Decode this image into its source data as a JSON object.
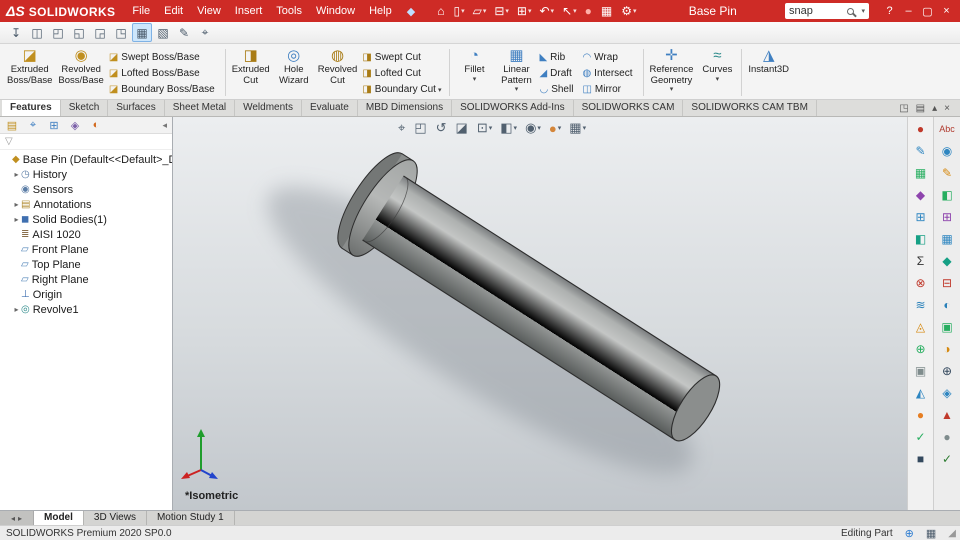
{
  "titlebar": {
    "logo_mark": "ΔS",
    "logo_text": "SOLIDWORKS",
    "menus": [
      "File",
      "Edit",
      "View",
      "Insert",
      "Tools",
      "Window",
      "Help"
    ],
    "pin_glyph": "◆",
    "quick_icons": [
      {
        "g": "⌂",
        "caret": ""
      },
      {
        "g": "▯",
        "caret": "▾"
      },
      {
        "g": "▱",
        "caret": "▾"
      },
      {
        "g": "⊟",
        "caret": "▾"
      },
      {
        "g": "⊞",
        "caret": "▾"
      },
      {
        "g": "↶",
        "caret": "▾"
      },
      {
        "g": "↖",
        "caret": "▾"
      },
      {
        "g": "●",
        "c": "#ffb0a8",
        "caret": ""
      },
      {
        "g": "▦",
        "caret": ""
      },
      {
        "g": "⚙",
        "caret": "▾"
      }
    ],
    "doc_title": "Base Pin",
    "search_value": "snap",
    "window_controls": [
      {
        "g": "?"
      },
      {
        "g": "–"
      },
      {
        "g": "▢"
      },
      {
        "g": "×"
      }
    ]
  },
  "quickbar": [
    {
      "g": "↧"
    },
    {
      "g": "◫"
    },
    {
      "g": "◰"
    },
    {
      "g": "◱"
    },
    {
      "g": "◲"
    },
    {
      "g": "◳"
    },
    {
      "g": "▦",
      "bg": "#cde6fb",
      "bc": "#7fb2e5"
    },
    {
      "g": "▧"
    },
    {
      "g": "✎"
    },
    {
      "g": "⌖"
    }
  ],
  "ribbon": {
    "large": [
      {
        "icon": "◪",
        "c": "#c08f1f",
        "label": "Extruded\nBoss/Base",
        "caret": ""
      },
      {
        "icon": "◉",
        "c": "#c08f1f",
        "label": "Revolved\nBoss/Base",
        "caret": ""
      },
      {
        "icon": "◨",
        "c": "#a97c16",
        "label": "Extruded\nCut",
        "caret": ""
      },
      {
        "icon": "◎",
        "c": "#3f7fc1",
        "label": "Hole\nWizard",
        "caret": ""
      },
      {
        "icon": "◍",
        "c": "#a97c16",
        "label": "Revolved\nCut",
        "caret": ""
      },
      {
        "icon": "◔",
        "c": "#3f7fc1",
        "label": "Fillet",
        "caret": "▾"
      },
      {
        "icon": "▦",
        "c": "#3f7fc1",
        "label": "Linear\nPattern",
        "caret": "▾"
      },
      {
        "icon": "✛",
        "c": "#3f7fc1",
        "label": "Reference\nGeometry",
        "caret": "▾"
      },
      {
        "icon": "≈",
        "c": "#2e8b8b",
        "label": "Curves",
        "caret": "▾"
      },
      {
        "icon": "◮",
        "c": "#3f7fc1",
        "label": "Instant3D",
        "caret": ""
      }
    ],
    "cols_boss": [
      {
        "g": "◪",
        "c": "#c08f1f",
        "label": "Swept Boss/Base",
        "caret": ""
      },
      {
        "g": "◪",
        "c": "#c08f1f",
        "label": "Lofted Boss/Base",
        "caret": ""
      },
      {
        "g": "◪",
        "c": "#c08f1f",
        "label": "Boundary Boss/Base",
        "caret": ""
      }
    ],
    "cols_cut": [
      {
        "g": "◨",
        "c": "#a97c16",
        "label": "Swept Cut",
        "caret": ""
      },
      {
        "g": "◨",
        "c": "#a97c16",
        "label": "Lofted Cut",
        "caret": ""
      },
      {
        "g": "◨",
        "c": "#a97c16",
        "label": "Boundary Cut",
        "caret": "▾"
      }
    ],
    "cols_feat": [
      {
        "g": "◣",
        "c": "#3f7fc1",
        "label": "Rib",
        "caret": ""
      },
      {
        "g": "◢",
        "c": "#3f7fc1",
        "label": "Draft",
        "caret": ""
      },
      {
        "g": "◡",
        "c": "#3f7fc1",
        "label": "Shell",
        "caret": ""
      }
    ],
    "cols_feat2": [
      {
        "g": "◠",
        "c": "#3f7fc1",
        "label": "Wrap",
        "caret": ""
      },
      {
        "g": "◍",
        "c": "#3f7fc1",
        "label": "Intersect",
        "caret": ""
      },
      {
        "g": "◫",
        "c": "#3f7fc1",
        "label": "Mirror",
        "caret": ""
      }
    ]
  },
  "command_tabs": [
    {
      "label": "Features",
      "bg": "#ffffff",
      "fw": "bold"
    },
    {
      "label": "Sketch"
    },
    {
      "label": "Surfaces"
    },
    {
      "label": "Sheet Metal"
    },
    {
      "label": "Weldments"
    },
    {
      "label": "Evaluate"
    },
    {
      "label": "MBD Dimensions"
    },
    {
      "label": "SOLIDWORKS Add-Ins"
    },
    {
      "label": "SOLIDWORKS CAM"
    },
    {
      "label": "SOLIDWORKS CAM TBM"
    }
  ],
  "tabstrip_icons": [
    {
      "g": "◳"
    },
    {
      "g": "▤"
    },
    {
      "g": "▴"
    },
    {
      "g": "×"
    }
  ],
  "panel": {
    "tabs": [
      {
        "g": "▤",
        "c": "#c08f1f"
      },
      {
        "g": "⌖",
        "c": "#3f7fc1"
      },
      {
        "g": "⊞",
        "c": "#3f7fc1"
      },
      {
        "g": "◈",
        "c": "#7a5fa8"
      },
      {
        "g": "◐",
        "c": "#d2691e"
      }
    ],
    "collapse_glyph": "◂",
    "filter_glyph": "▽",
    "tree": [
      {
        "g": "◆",
        "c": "#c08f1f",
        "label": "Base Pin (Default<<Default>_Display",
        "arrow": "",
        "pad": "3px"
      },
      {
        "g": "◷",
        "c": "#5b7da6",
        "label": "History",
        "arrow": "▸",
        "pad": "12px"
      },
      {
        "g": "◉",
        "c": "#5b7da6",
        "label": "Sensors",
        "arrow": "",
        "pad": "12px"
      },
      {
        "g": "▤",
        "c": "#b08a2e",
        "label": "Annotations",
        "arrow": "▸",
        "pad": "12px"
      },
      {
        "g": "◼",
        "c": "#3f6fb0",
        "label": "Solid Bodies(1)",
        "arrow": "▸",
        "pad": "12px"
      },
      {
        "g": "≣",
        "c": "#8a6f4c",
        "label": "AISI 1020",
        "arrow": "",
        "pad": "12px"
      },
      {
        "g": "▱",
        "c": "#4a7fb5",
        "label": "Front Plane",
        "arrow": "",
        "pad": "12px"
      },
      {
        "g": "▱",
        "c": "#4a7fb5",
        "label": "Top Plane",
        "arrow": "",
        "pad": "12px"
      },
      {
        "g": "▱",
        "c": "#4a7fb5",
        "label": "Right Plane",
        "arrow": "",
        "pad": "12px"
      },
      {
        "g": "⊥",
        "c": "#3f6fb0",
        "label": "Origin",
        "arrow": "",
        "pad": "12px"
      },
      {
        "g": "◎",
        "c": "#2e8b8b",
        "label": "Revolve1",
        "arrow": "▸",
        "pad": "12px"
      }
    ]
  },
  "viewport": {
    "view_label": "*Isometric"
  },
  "headsup": [
    {
      "g": "⌖",
      "caret": ""
    },
    {
      "g": "◰",
      "caret": ""
    },
    {
      "g": "↺",
      "caret": ""
    },
    {
      "g": "◪",
      "caret": ""
    },
    {
      "g": "⊡",
      "caret": "▾"
    },
    {
      "g": "◧",
      "caret": "▾"
    },
    {
      "g": "◉",
      "caret": "▾"
    },
    {
      "g": "●",
      "c": "#d4863a",
      "caret": "▾"
    },
    {
      "g": "▦",
      "caret": "▾"
    }
  ],
  "right_toolbar_inner": [
    {
      "g": "●",
      "c": "#c0392b"
    },
    {
      "g": "✎",
      "c": "#2e86c1"
    },
    {
      "g": "▦",
      "c": "#27ae60"
    },
    {
      "g": "◆",
      "c": "#8e44ad"
    },
    {
      "g": "⊞",
      "c": "#2e86c1"
    },
    {
      "g": "◧",
      "c": "#16a085"
    },
    {
      "g": "Σ",
      "c": "#333333"
    },
    {
      "g": "⊗",
      "c": "#c0392b"
    },
    {
      "g": "≋",
      "c": "#2980b9"
    },
    {
      "g": "◬",
      "c": "#d68910"
    },
    {
      "g": "⊕",
      "c": "#27ae60"
    },
    {
      "g": "▣",
      "c": "#7f8c8d"
    },
    {
      "g": "◭",
      "c": "#2e86c1"
    },
    {
      "g": "●",
      "c": "#e67e22"
    },
    {
      "g": "✓",
      "c": "#27ae60"
    },
    {
      "g": "■",
      "c": "#34495e"
    }
  ],
  "right_toolbar_outer": [
    {
      "g": "Abc",
      "c": "#b03a2e",
      "fs": "9px"
    },
    {
      "g": "◉",
      "c": "#2e86c1"
    },
    {
      "g": "✎",
      "c": "#d68910"
    },
    {
      "g": "◧",
      "c": "#27ae60"
    },
    {
      "g": "⊞",
      "c": "#8e44ad"
    },
    {
      "g": "▦",
      "c": "#2e86c1"
    },
    {
      "g": "◆",
      "c": "#16a085"
    },
    {
      "g": "⊟",
      "c": "#c0392b"
    },
    {
      "g": "◐",
      "c": "#2980b9"
    },
    {
      "g": "▣",
      "c": "#27ae60"
    },
    {
      "g": "◑",
      "c": "#d68910"
    },
    {
      "g": "⊕",
      "c": "#34495e"
    },
    {
      "g": "◈",
      "c": "#2e86c1"
    },
    {
      "g": "▲",
      "c": "#c0392b"
    },
    {
      "g": "●",
      "c": "#7f8c8d"
    },
    {
      "g": "✓",
      "c": "#2e7d32"
    }
  ],
  "bottom_tabs": [
    {
      "label": "Model",
      "bg": "#ffffff",
      "fw": "bold"
    },
    {
      "label": "3D Views"
    },
    {
      "label": "Motion Study 1"
    }
  ],
  "tab_scroll": [
    {
      "g": "◂"
    },
    {
      "g": "▸"
    }
  ],
  "statusbar": {
    "left": "SOLIDWORKS Premium 2020 SP0.0",
    "right": "Editing Part",
    "icons": [
      {
        "g": "⊕",
        "c": "#2e7dd1"
      },
      {
        "g": "▦",
        "c": "#4a5a6a"
      }
    ],
    "grip": "◢"
  }
}
